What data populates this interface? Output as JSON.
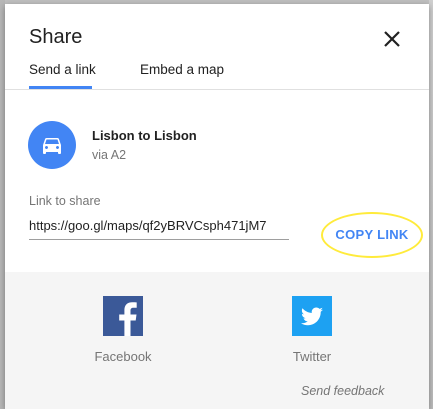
{
  "dialog": {
    "title": "Share",
    "close_icon": "close-icon"
  },
  "tabs": [
    {
      "label": "Send a link",
      "active": true
    },
    {
      "label": "Embed a map",
      "active": false
    }
  ],
  "route": {
    "icon": "car-icon",
    "title": "Lisbon to Lisbon",
    "subtitle": "via A2"
  },
  "link": {
    "label": "Link to share",
    "value": "https://goo.gl/maps/qf2yBRVCsph471jM7",
    "copy_label": "COPY LINK"
  },
  "social": [
    {
      "name": "Facebook",
      "icon": "facebook-icon",
      "color": "#3b5998"
    },
    {
      "name": "Twitter",
      "icon": "twitter-icon",
      "color": "#1da1f2"
    }
  ],
  "footer": {
    "feedback_label": "Send feedback"
  },
  "colors": {
    "accent": "#4285f4",
    "highlight": "#ffeb3b"
  }
}
